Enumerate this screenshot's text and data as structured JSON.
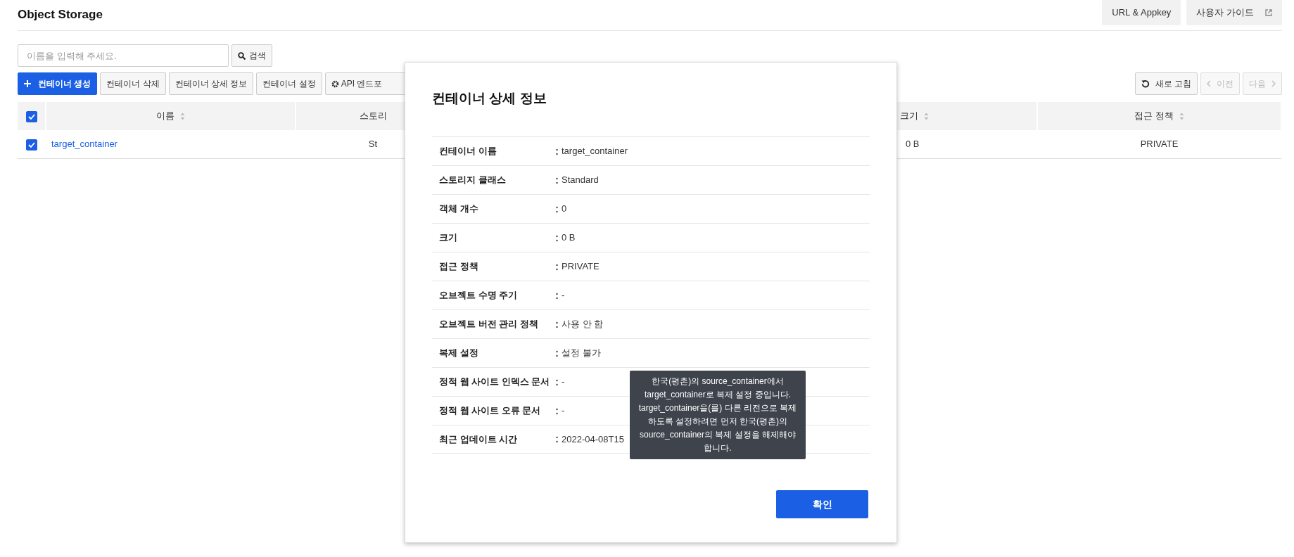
{
  "header": {
    "title": "Object Storage",
    "buttons": [
      {
        "label": "URL & Appkey",
        "external": false
      },
      {
        "label": "사용자 가이드",
        "external": true
      }
    ]
  },
  "search": {
    "placeholder": "이름을 입력해 주세요.",
    "button": "검색"
  },
  "toolbar": [
    {
      "label": "컨테이너 생성",
      "kind": "primary"
    },
    {
      "label": "컨테이너 삭제",
      "kind": "plain"
    },
    {
      "label": "컨테이너 상세 정보",
      "kind": "plain"
    },
    {
      "label": "컨테이너 설정",
      "kind": "plain"
    },
    {
      "label": "API 엔드포",
      "kind": "settings"
    }
  ],
  "nav": [
    {
      "label": "새로 고침",
      "kind": "refresh",
      "disabled": false
    },
    {
      "label": "이전",
      "kind": "prev",
      "disabled": true
    },
    {
      "label": "다음",
      "kind": "next",
      "disabled": true
    }
  ],
  "table": {
    "select_all": {
      "checked": true
    },
    "columns": [
      "이름",
      "스토리",
      "크기",
      "접근 정책"
    ],
    "rows": [
      {
        "checked": true,
        "cells": [
          "target_container",
          "St",
          "0 B",
          "PRIVATE"
        ]
      }
    ]
  },
  "modal": {
    "title": "컨테이너 상세 정보",
    "fields": [
      {
        "label": "컨테이너 이름",
        "value": "target_container"
      },
      {
        "label": "스토리지 클래스",
        "value": "Standard"
      },
      {
        "label": "객체 개수",
        "value": "0"
      },
      {
        "label": "크기",
        "value": "0 B"
      },
      {
        "label": "접근 정책",
        "value": "PRIVATE"
      },
      {
        "label": "오브젝트 수명 주기",
        "value": "-"
      },
      {
        "label": "오브젝트 버전 관리 정책",
        "value": "사용 안 함"
      },
      {
        "label": "복제 설정",
        "value": "설정 불가"
      },
      {
        "label": "정적 웹 사이트 인덱스 문서",
        "value": "-"
      },
      {
        "label": "정적 웹 사이트 오류 문서",
        "value": "-"
      },
      {
        "label": "최근 업데이트 시간",
        "value": "2022-04-08T15"
      }
    ],
    "confirm": "확인"
  },
  "tooltip": {
    "text": "한국(평촌)의 source_container에서 target_container로 복제 설정 중입니다. target_container을(를) 다른 리전으로 복제하도록 설정하려면 먼저 한국(평촌)의 source_container의 복제 설정을 해제해야 합니다."
  }
}
